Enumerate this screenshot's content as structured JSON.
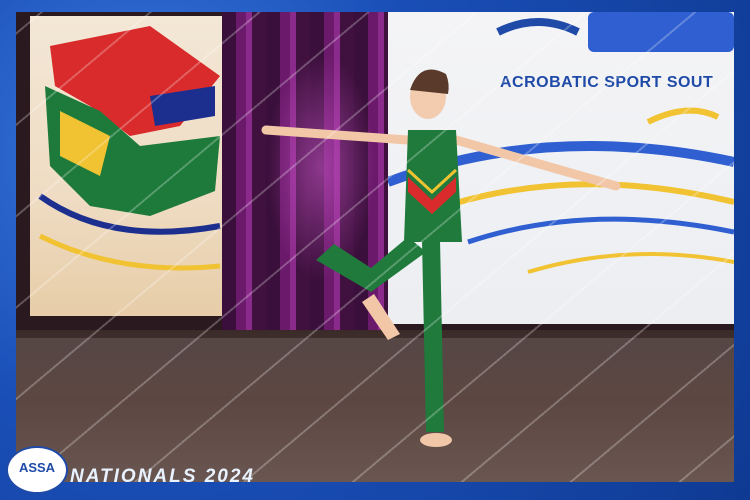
{
  "image": {
    "backdrop_text": "ACROBATIC SPORT SOUT",
    "badge_text": "ASSA",
    "footer_text": "NATIONALS 2024"
  },
  "colors": {
    "frame": "#1a4fb8",
    "leotard": "#1f7a3c",
    "sport_text": "#1f4aa8"
  }
}
